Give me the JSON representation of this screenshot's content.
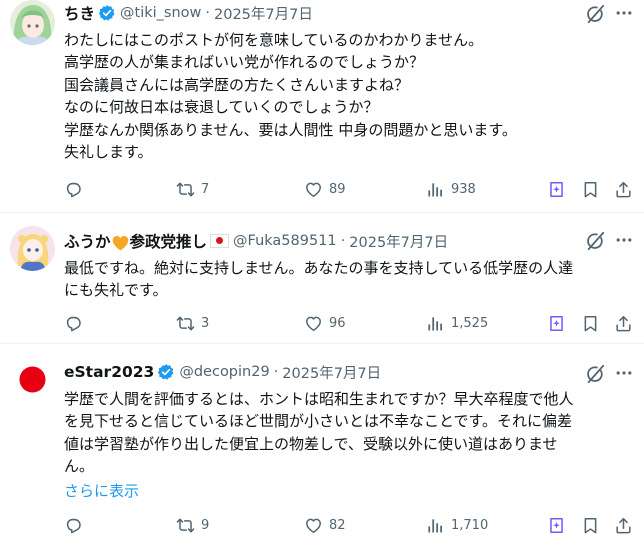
{
  "tweets": [
    {
      "name": "ちき",
      "verified": true,
      "handle": "@tiki_snow",
      "date": "2025年7月7日",
      "lines": [
        "わたしにはこのポストが何を意味しているのかわかりません。",
        "高学歴の人が集まればいい党が作れるのでしょうか？",
        "国会議員さんには高学歴の方たくさんいますよね？",
        "なのに何故日本は衰退していくのでしょうか？",
        "学歴なんか関係ありません、要は人間性 中身の問題かと思います。",
        "失礼します。"
      ],
      "reposts": "7",
      "likes": "89",
      "views": "938"
    },
    {
      "name_pre": "ふうか",
      "name_post": "参政党推し",
      "handle": "@Fuka589511",
      "date": "2025年7月7日",
      "lines": [
        "最低ですね。絶対に支持しません。あなたの事を支持している低学歴の人達",
        "にも失礼です。"
      ],
      "reposts": "3",
      "likes": "96",
      "views": "1,525"
    },
    {
      "name": "eStar2023",
      "verified": true,
      "handle": "@decopin29",
      "date": "2025年7月7日",
      "lines": [
        "学歴で人間を評価するとは、ホントは昭和生まれですか？早大卒程度で他人",
        "を見下せると信じているほど世間が小さいとは不幸なことです。それに偏差",
        "値は学習塾が作り出した便宜上の物差しで、受験以外に使い道はありませ",
        "ん。"
      ],
      "show_more": "さらに表示",
      "reposts": "9",
      "likes": "82",
      "views": "1,710"
    }
  ],
  "colors": {
    "accent": "#1d9bf0",
    "secondary_text": "#536471",
    "primary_text": "#0f1419",
    "grok_purple": "#7856ff"
  }
}
